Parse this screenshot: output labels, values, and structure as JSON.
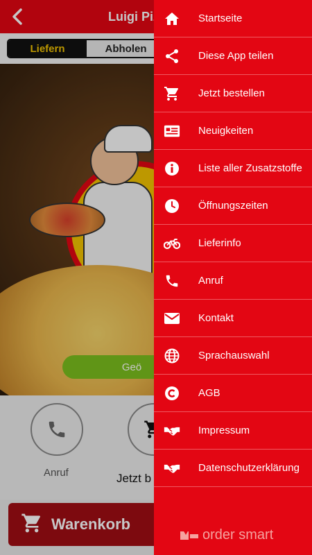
{
  "app": {
    "title": "Luigi Piz",
    "tabs": [
      {
        "label": "Liefern",
        "active": true
      },
      {
        "label": "Abholen",
        "active": false
      }
    ],
    "hero_button": "Geö",
    "actions": [
      {
        "label": "Anruf",
        "icon": "phone-icon"
      },
      {
        "label": "Jetzt b",
        "icon": "cart-icon"
      }
    ],
    "cart_label": "Warenkorb"
  },
  "drawer": {
    "items": [
      {
        "label": "Startseite",
        "icon": "home-icon"
      },
      {
        "label": "Diese App teilen",
        "icon": "share-icon"
      },
      {
        "label": "Jetzt bestellen",
        "icon": "cart-icon"
      },
      {
        "label": "Neuigkeiten",
        "icon": "newspaper-icon"
      },
      {
        "label": "Liste aller Zusatzstoffe",
        "icon": "info-icon"
      },
      {
        "label": "Öffnungszeiten",
        "icon": "clock-icon"
      },
      {
        "label": "Lieferinfo",
        "icon": "motorcycle-icon"
      },
      {
        "label": "Anruf",
        "icon": "phone-icon"
      },
      {
        "label": "Kontakt",
        "icon": "mail-icon"
      },
      {
        "label": "Sprachauswahl",
        "icon": "globe-icon"
      },
      {
        "label": "AGB",
        "icon": "copyright-icon"
      },
      {
        "label": "Impressum",
        "icon": "handshake-icon"
      },
      {
        "label": "Datenschutzerklärung",
        "icon": "handshake-icon"
      }
    ],
    "brand": "order smart"
  },
  "colors": {
    "primary": "#e30613",
    "dark_red": "#a00d14",
    "accent_yellow": "#f2c300",
    "green": "#7cbf1e"
  }
}
